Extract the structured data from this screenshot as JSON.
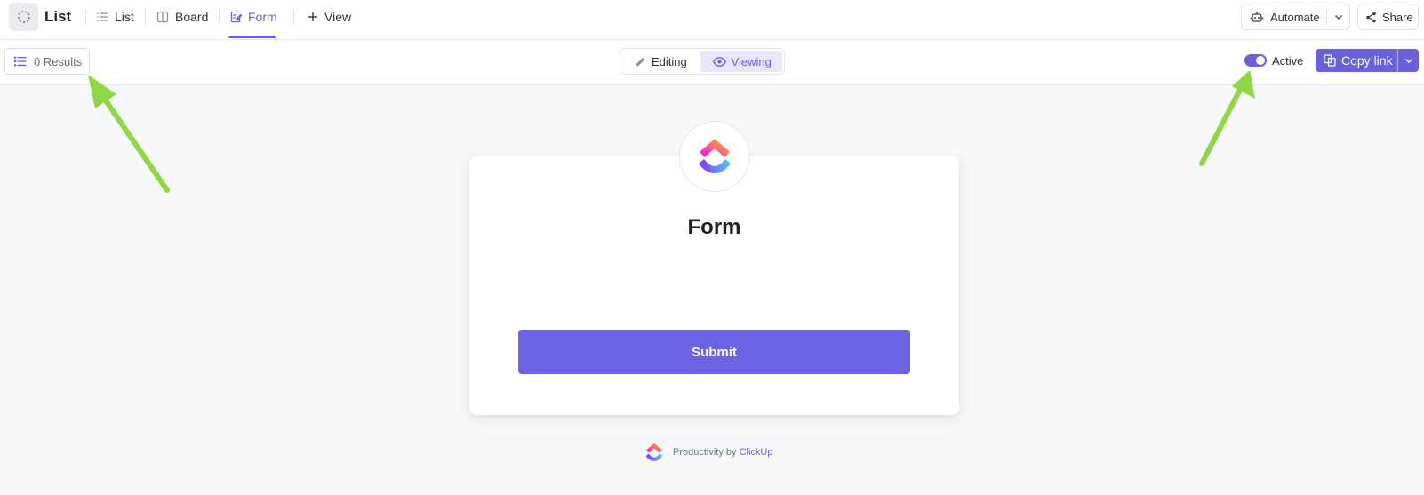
{
  "header": {
    "title": "List",
    "list_icon": "dotted-circle-icon",
    "views": [
      {
        "label": "List",
        "icon": "list-icon"
      },
      {
        "label": "Board",
        "icon": "board-icon"
      },
      {
        "label": "Form",
        "icon": "form-icon",
        "active": true
      }
    ],
    "add_view_label": "View",
    "automate_label": "Automate",
    "share_label": "Share"
  },
  "toolbar": {
    "results_label": "0 Results",
    "mode_editing_label": "Editing",
    "mode_viewing_label": "Viewing",
    "mode_selected": "Viewing",
    "active_label": "Active",
    "active_on": true,
    "copy_link_label": "Copy link"
  },
  "form": {
    "title": "Form",
    "submit_label": "Submit"
  },
  "footer": {
    "text": "Productivity by",
    "link": "ClickUp"
  },
  "colors": {
    "accent": "#6a5fdc",
    "submit": "#6b62e4",
    "annotation_arrow": "#8fd744"
  }
}
